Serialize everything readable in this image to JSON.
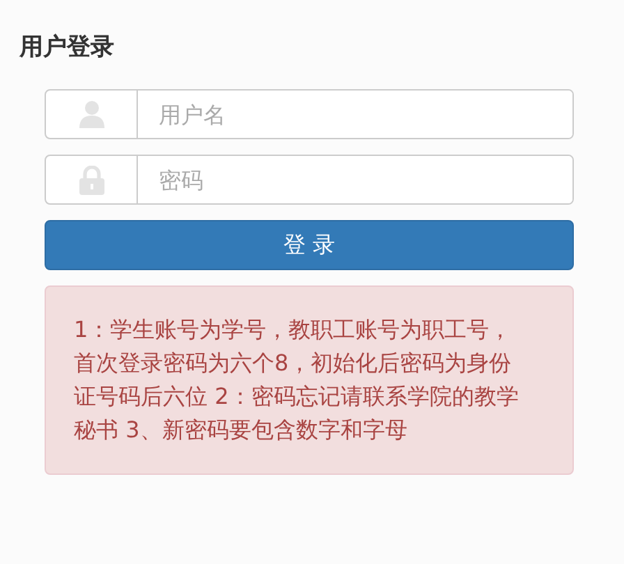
{
  "title": "用户登录",
  "fields": [
    {
      "kind": "user",
      "placeholder": "用户名"
    },
    {
      "kind": "lock",
      "placeholder": "密码"
    }
  ],
  "login_button": "登 录",
  "notice": "1：学生账号为学号，教职工账号为职工号，首次登录密码为六个8，初始化后密码为身份证号码后六位 2：密码忘记请联系学院的教学秘书 3、新密码要包含数字和字母"
}
